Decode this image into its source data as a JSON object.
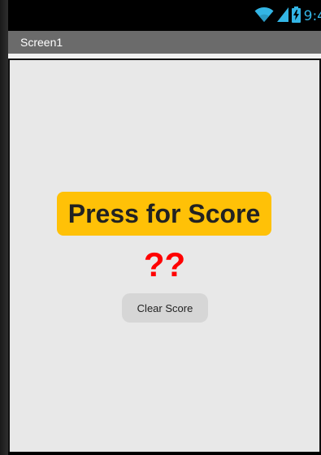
{
  "status_bar": {
    "time": "9:4",
    "icons": [
      "wifi-icon",
      "signal-icon",
      "battery-charging-icon"
    ],
    "accent_color": "#33b5e5"
  },
  "title_bar": {
    "title": "Screen1",
    "background_color": "#6b6b6b"
  },
  "main": {
    "press_button_label": "Press for Score",
    "press_button_color": "#ffc107",
    "score_text": "??",
    "score_color": "#ff0000",
    "clear_button_label": "Clear Score",
    "clear_button_color": "#d6d6d6",
    "background_color": "#e8e8e8"
  }
}
